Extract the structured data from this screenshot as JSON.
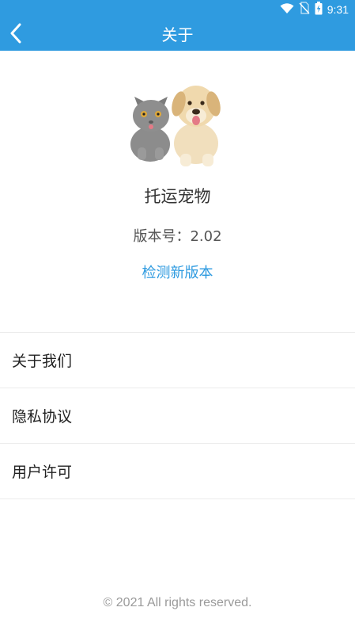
{
  "status_bar": {
    "time": "9:31",
    "icons": [
      "wifi-icon",
      "no-signal-icon",
      "battery-charging-icon"
    ]
  },
  "header": {
    "title": "关于",
    "back_icon": "chevron-left-icon",
    "background_color": "#2f9be0"
  },
  "app": {
    "name": "托运宠物",
    "version_text": "版本号：2.02",
    "check_update_label": "检测新版本",
    "illustration": "cat-and-dog-image"
  },
  "menu": {
    "items": [
      {
        "label": "关于我们"
      },
      {
        "label": "隐私协议"
      },
      {
        "label": "用户许可"
      }
    ]
  },
  "footer": {
    "copyright": "© 2021 All rights reserved."
  }
}
